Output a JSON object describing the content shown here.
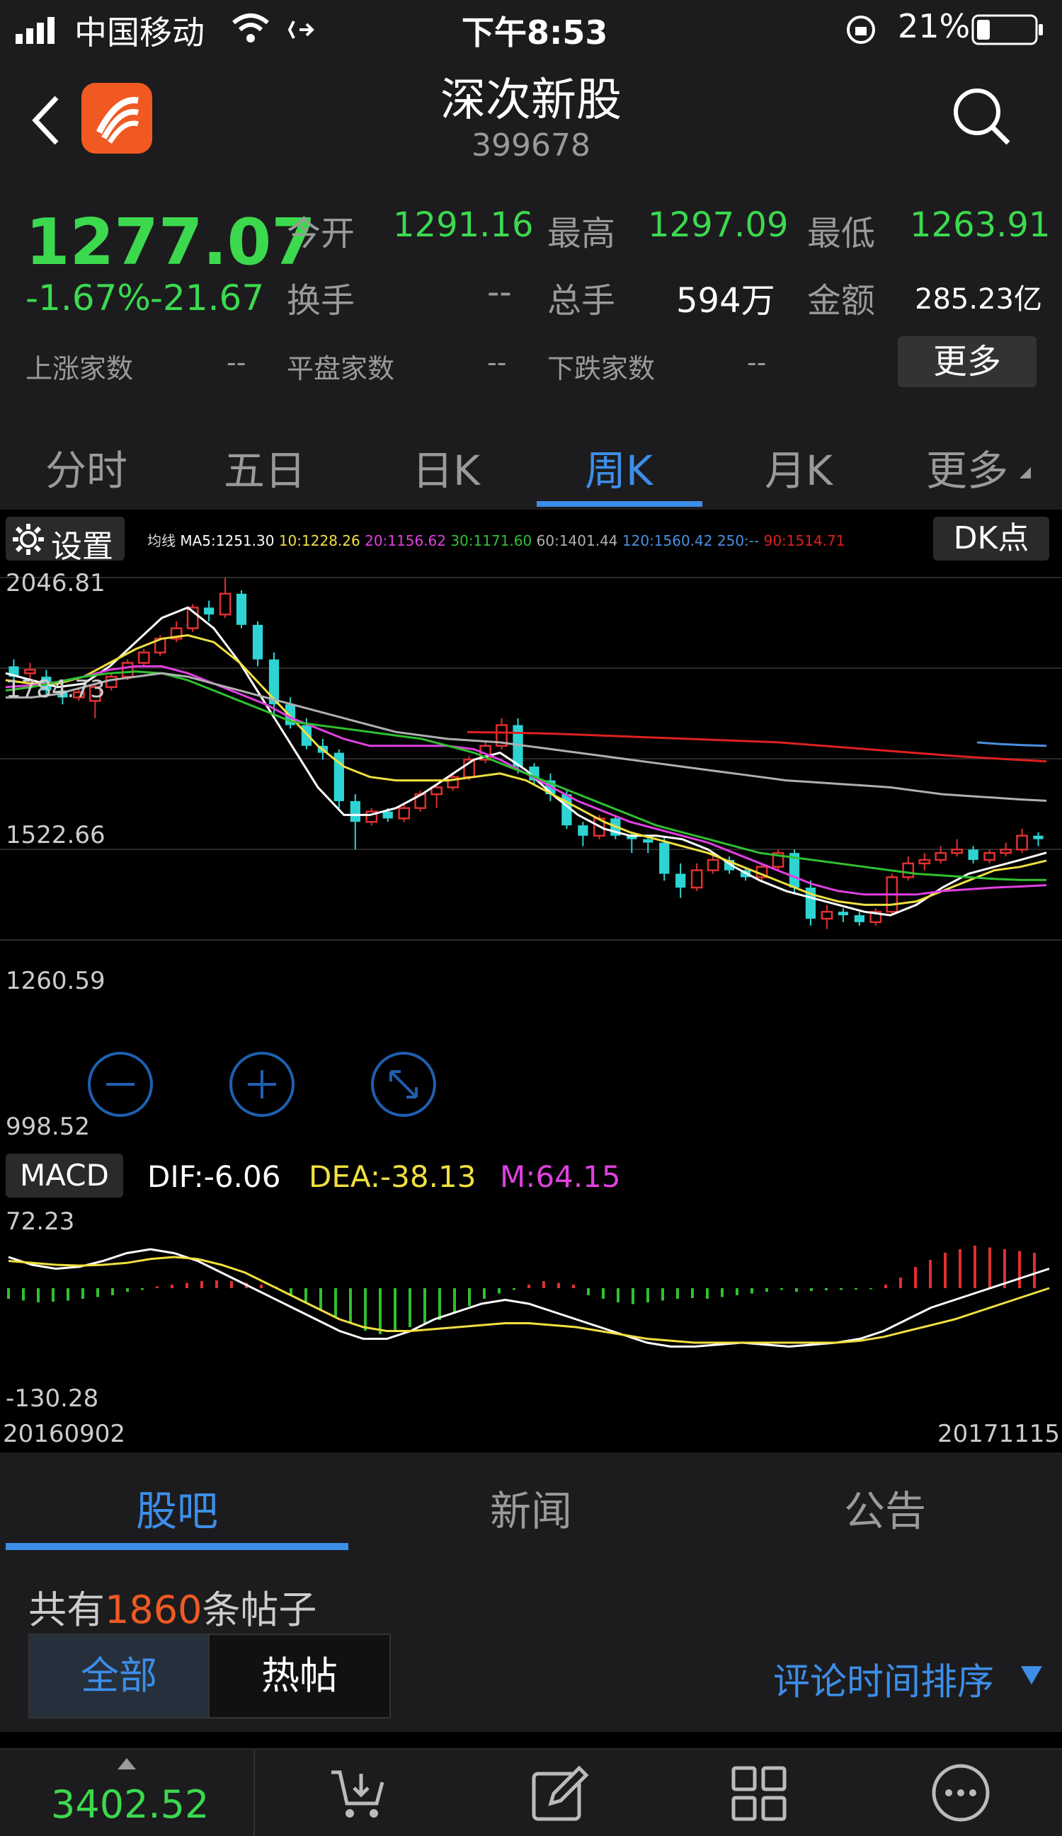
{
  "status_bar": {
    "carrier": "中国移动",
    "time": "下午8:53",
    "battery": "21%"
  },
  "header": {
    "title": "深次新股",
    "code": "399678"
  },
  "quote": {
    "price": "1277.07",
    "change_pct": "-1.67%",
    "change_abs": "-21.67",
    "open_label": "今开",
    "open": "1291.16",
    "high_label": "最高",
    "high": "1297.09",
    "low_label": "最低",
    "low": "1263.91",
    "turnover_label": "换手",
    "turnover": "--",
    "volume_label": "总手",
    "volume": "594万",
    "amount_label": "金额",
    "amount": "285.23亿",
    "up_label": "上涨家数",
    "up": "--",
    "flat_label": "平盘家数",
    "flat": "--",
    "down_label": "下跌家数",
    "down": "--",
    "more_button": "更多"
  },
  "period_tabs": [
    "分时",
    "五日",
    "日K",
    "周K",
    "月K",
    "更多"
  ],
  "active_period": 3,
  "chart_toolbar": {
    "settings": "设置",
    "ma_title": "均线",
    "ma": [
      {
        "label": "MA5:1251.30",
        "color": "#ffffff"
      },
      {
        "label": "10:1228.26",
        "color": "#f0e040"
      },
      {
        "label": "20:1156.62",
        "color": "#e040e0"
      },
      {
        "label": "30:1171.60",
        "color": "#30c030"
      },
      {
        "label": "60:1401.44",
        "color": "#b0b0b0"
      },
      {
        "label": "120:1560.42",
        "color": "#4a90e2"
      },
      {
        "label": "250:--",
        "color": "#4a90e2"
      },
      {
        "label": "90:1514.71",
        "color": "#e02020"
      }
    ],
    "dk_button": "DK点"
  },
  "price_axis": [
    "2046.81",
    "1784.73",
    "1522.66",
    "1260.59",
    "998.52"
  ],
  "macd": {
    "label": "MACD",
    "dif": "DIF:-6.06",
    "dea": "DEA:-38.13",
    "m": "M:64.15",
    "axis_top": "72.23",
    "axis_bottom": "-130.28"
  },
  "date_axis": {
    "start": "20160902",
    "end": "20171115"
  },
  "content_tabs": [
    "股吧",
    "新闻",
    "公告"
  ],
  "posts": {
    "prefix": "共有",
    "count": "1860",
    "suffix": "条帖子",
    "filter_all": "全部",
    "filter_hot": "热帖",
    "sort": "评论时间排序"
  },
  "footer": {
    "index_value": "3402.52"
  },
  "colors": {
    "up": "#e03030",
    "down": "#2ed4d4",
    "accent": "#3d8ee8",
    "price_green": "#3cd94f",
    "brand_orange": "#f05a22"
  },
  "chart_data": {
    "type": "candlestick",
    "ylim": [
      998.52,
      2046.81
    ],
    "x_range": [
      "20160902",
      "20171115"
    ],
    "candles": [
      [
        1790,
        1760,
        1810,
        1740
      ],
      [
        1770,
        1780,
        1800,
        1750
      ],
      [
        1760,
        1720,
        1780,
        1700
      ],
      [
        1720,
        1700,
        1740,
        1680
      ],
      [
        1700,
        1715,
        1730,
        1690
      ],
      [
        1690,
        1730,
        1740,
        1640
      ],
      [
        1730,
        1760,
        1770,
        1720
      ],
      [
        1760,
        1800,
        1810,
        1750
      ],
      [
        1800,
        1830,
        1840,
        1790
      ],
      [
        1830,
        1870,
        1880,
        1820
      ],
      [
        1870,
        1900,
        1920,
        1860
      ],
      [
        1900,
        1960,
        1970,
        1890
      ],
      [
        1960,
        1940,
        1980,
        1920
      ],
      [
        1940,
        2000,
        2046,
        1930
      ],
      [
        2000,
        1910,
        2010,
        1900
      ],
      [
        1910,
        1810,
        1920,
        1790
      ],
      [
        1810,
        1680,
        1830,
        1650
      ],
      [
        1680,
        1620,
        1700,
        1610
      ],
      [
        1620,
        1560,
        1640,
        1550
      ],
      [
        1560,
        1540,
        1580,
        1520
      ],
      [
        1540,
        1400,
        1550,
        1380
      ],
      [
        1400,
        1340,
        1420,
        1260
      ],
      [
        1340,
        1370,
        1380,
        1330
      ],
      [
        1370,
        1350,
        1380,
        1340
      ],
      [
        1350,
        1380,
        1390,
        1340
      ],
      [
        1380,
        1420,
        1430,
        1370
      ],
      [
        1420,
        1440,
        1450,
        1380
      ],
      [
        1440,
        1470,
        1480,
        1430
      ],
      [
        1470,
        1520,
        1530,
        1460
      ],
      [
        1520,
        1560,
        1570,
        1510
      ],
      [
        1560,
        1620,
        1640,
        1550
      ],
      [
        1620,
        1500,
        1640,
        1480
      ],
      [
        1500,
        1460,
        1510,
        1450
      ],
      [
        1460,
        1420,
        1480,
        1400
      ],
      [
        1420,
        1330,
        1430,
        1320
      ],
      [
        1330,
        1300,
        1340,
        1270
      ],
      [
        1300,
        1350,
        1360,
        1290
      ],
      [
        1350,
        1300,
        1360,
        1290
      ],
      [
        1300,
        1290,
        1310,
        1250
      ],
      [
        1290,
        1280,
        1300,
        1250
      ],
      [
        1280,
        1190,
        1300,
        1170
      ],
      [
        1190,
        1150,
        1220,
        1120
      ],
      [
        1150,
        1200,
        1220,
        1140
      ],
      [
        1200,
        1230,
        1250,
        1190
      ],
      [
        1230,
        1200,
        1240,
        1190
      ],
      [
        1200,
        1180,
        1210,
        1170
      ],
      [
        1180,
        1210,
        1220,
        1170
      ],
      [
        1210,
        1250,
        1260,
        1200
      ],
      [
        1250,
        1150,
        1260,
        1130
      ],
      [
        1150,
        1060,
        1170,
        1040
      ],
      [
        1060,
        1080,
        1100,
        1030
      ],
      [
        1080,
        1070,
        1090,
        1050
      ],
      [
        1070,
        1050,
        1080,
        1040
      ],
      [
        1050,
        1080,
        1090,
        1040
      ],
      [
        1080,
        1180,
        1190,
        1070
      ],
      [
        1180,
        1220,
        1240,
        1170
      ],
      [
        1220,
        1230,
        1250,
        1200
      ],
      [
        1230,
        1250,
        1270,
        1220
      ],
      [
        1250,
        1260,
        1290,
        1240
      ],
      [
        1260,
        1230,
        1270,
        1220
      ],
      [
        1230,
        1250,
        1260,
        1220
      ],
      [
        1250,
        1260,
        1280,
        1240
      ],
      [
        1260,
        1300,
        1320,
        1250
      ],
      [
        1300,
        1290,
        1310,
        1270
      ]
    ],
    "series": [
      {
        "name": "MA5",
        "color": "#ffffff",
        "values": [
          1770,
          1750,
          1730,
          1740,
          1790,
          1860,
          1930,
          1960,
          1900,
          1800,
          1680,
          1560,
          1440,
          1360,
          1360,
          1380,
          1420,
          1470,
          1520,
          1540,
          1490,
          1420,
          1360,
          1320,
          1300,
          1300,
          1290,
          1260,
          1210,
          1170,
          1140,
          1120,
          1100,
          1080,
          1070,
          1100,
          1150,
          1190,
          1210,
          1230,
          1251
        ]
      },
      {
        "name": "10",
        "color": "#f0e040",
        "values": [
          1750,
          1740,
          1740,
          1760,
          1800,
          1840,
          1870,
          1880,
          1860,
          1800,
          1720,
          1640,
          1560,
          1500,
          1470,
          1460,
          1460,
          1460,
          1470,
          1480,
          1460,
          1420,
          1380,
          1340,
          1310,
          1290,
          1270,
          1250,
          1220,
          1190,
          1160,
          1130,
          1110,
          1100,
          1100,
          1110,
          1140,
          1170,
          1200,
          1210,
          1228
        ]
      },
      {
        "name": "20",
        "color": "#e040e0",
        "values": [
          1730,
          1735,
          1745,
          1760,
          1780,
          1790,
          1790,
          1770,
          1740,
          1710,
          1680,
          1640,
          1610,
          1580,
          1560,
          1560,
          1560,
          1560,
          1550,
          1520,
          1480,
          1440,
          1400,
          1370,
          1340,
          1320,
          1300,
          1280,
          1250,
          1220,
          1190,
          1160,
          1140,
          1130,
          1130,
          1130,
          1140,
          1145,
          1150,
          1153,
          1157
        ]
      },
      {
        "name": "30",
        "color": "#30c030",
        "values": [
          1720,
          1730,
          1745,
          1760,
          1770,
          1775,
          1770,
          1750,
          1720,
          1690,
          1660,
          1630,
          1620,
          1610,
          1600,
          1590,
          1580,
          1560,
          1540,
          1510,
          1480,
          1450,
          1420,
          1390,
          1360,
          1330,
          1310,
          1290,
          1270,
          1250,
          1240,
          1230,
          1220,
          1210,
          1200,
          1190,
          1185,
          1180,
          1175,
          1172,
          1172
        ]
      },
      {
        "name": "60",
        "color": "#b0b0b0",
        "values": [
          1700,
          1700,
          1710,
          1730,
          1750,
          1760,
          1770,
          1760,
          1740,
          1720,
          1700,
          1680,
          1660,
          1640,
          1620,
          1600,
          1590,
          1580,
          1575,
          1570,
          1560,
          1550,
          1540,
          1530,
          1520,
          1510,
          1500,
          1490,
          1480,
          1470,
          1460,
          1455,
          1450,
          1445,
          1440,
          1430,
          1420,
          1415,
          1410,
          1405,
          1401
        ]
      },
      {
        "name": "90",
        "color": "#e02020",
        "values": [
          1600,
          1598,
          1595,
          1590,
          1585,
          1580,
          1575,
          1570,
          1560,
          1550,
          1540,
          1530,
          1522,
          1515
        ]
      },
      {
        "name": "120",
        "color": "#4a90e2",
        "values": [
          1570,
          1565,
          1562,
          1560
        ]
      }
    ]
  }
}
